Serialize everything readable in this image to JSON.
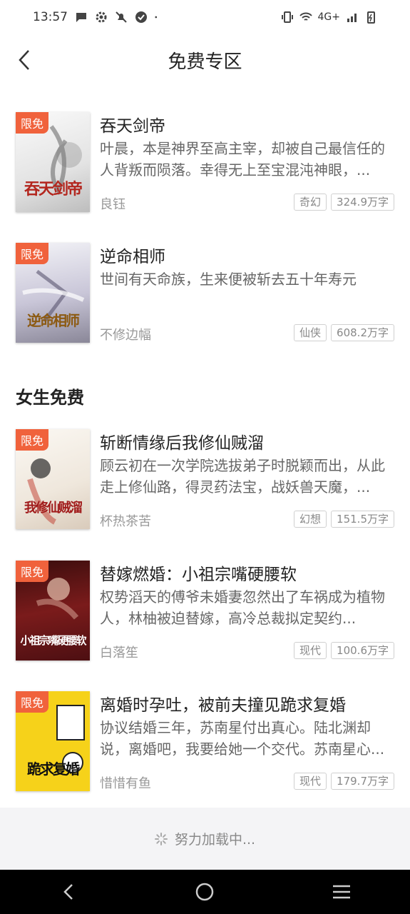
{
  "status_bar": {
    "time": "13:57",
    "network": "4G+"
  },
  "header": {
    "title": "免费专区"
  },
  "section_female": "女生免费",
  "badge_label": "限免",
  "books": [
    {
      "title": "吞天剑帝",
      "desc": "叶晨，本是神界至高主宰，却被自己最信任的人背叛而陨落。幸得无上至宝混沌神眼，...",
      "author": "良钰",
      "genre": "奇幻",
      "words": "324.9万字",
      "cover_text": "吞天剑帝",
      "cover_color": "#f4f4f4"
    },
    {
      "title": "逆命相师",
      "desc": "世间有天命族，生来便被斩去五十年寿元",
      "author": "不修边幅",
      "genre": "仙侠",
      "words": "608.2万字",
      "cover_text": "逆命相师",
      "cover_color": "#e8e6ef"
    },
    {
      "title": "斩断情缘后我修仙贼溜",
      "desc": "顾云初在一次学院选拔弟子时脱颖而出，从此走上修仙路，得灵药法宝，战妖兽天魔，...",
      "author": "杯热茶苦",
      "genre": "幻想",
      "words": "151.5万字",
      "cover_text": "我修仙贼溜",
      "cover_color": "#f5f1ec"
    },
    {
      "title": "替嫁燃婚：小祖宗嘴硬腰软",
      "desc": "权势滔天的傅爷未婚妻忽然出了车祸成为植物人，林柚被迫替嫁，高冷总裁拟定契约...",
      "author": "白落笙",
      "genre": "现代",
      "words": "100.6万字",
      "cover_text": "小祖宗嘴硬腰软",
      "cover_color": "#7a1b1b"
    },
    {
      "title": "离婚时孕吐，被前夫撞见跪求复婚",
      "desc": "协议结婚三年，苏南星付出真心。陆北渊却说，离婚吧，我要给她一个交代。苏南星心...",
      "author": "惜惜有鱼",
      "genre": "现代",
      "words": "179.7万字",
      "cover_text": "跪求复婚",
      "cover_color": "#f6d21a"
    }
  ],
  "loading_text": "努力加载中...",
  "colors": {
    "badge": "#f0623c",
    "background": "#ffffff",
    "nav_bar": "#000000"
  }
}
